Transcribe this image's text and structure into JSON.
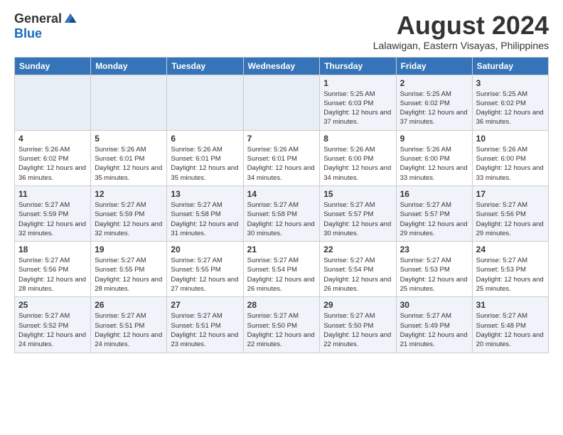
{
  "header": {
    "logo_general": "General",
    "logo_blue": "Blue",
    "month_year": "August 2024",
    "location": "Lalawigan, Eastern Visayas, Philippines"
  },
  "days_of_week": [
    "Sunday",
    "Monday",
    "Tuesday",
    "Wednesday",
    "Thursday",
    "Friday",
    "Saturday"
  ],
  "weeks": [
    [
      {
        "day": "",
        "info": ""
      },
      {
        "day": "",
        "info": ""
      },
      {
        "day": "",
        "info": ""
      },
      {
        "day": "",
        "info": ""
      },
      {
        "day": "1",
        "info": "Sunrise: 5:25 AM\nSunset: 6:03 PM\nDaylight: 12 hours and 37 minutes."
      },
      {
        "day": "2",
        "info": "Sunrise: 5:25 AM\nSunset: 6:02 PM\nDaylight: 12 hours and 37 minutes."
      },
      {
        "day": "3",
        "info": "Sunrise: 5:25 AM\nSunset: 6:02 PM\nDaylight: 12 hours and 36 minutes."
      }
    ],
    [
      {
        "day": "4",
        "info": "Sunrise: 5:26 AM\nSunset: 6:02 PM\nDaylight: 12 hours and 36 minutes."
      },
      {
        "day": "5",
        "info": "Sunrise: 5:26 AM\nSunset: 6:01 PM\nDaylight: 12 hours and 35 minutes."
      },
      {
        "day": "6",
        "info": "Sunrise: 5:26 AM\nSunset: 6:01 PM\nDaylight: 12 hours and 35 minutes."
      },
      {
        "day": "7",
        "info": "Sunrise: 5:26 AM\nSunset: 6:01 PM\nDaylight: 12 hours and 34 minutes."
      },
      {
        "day": "8",
        "info": "Sunrise: 5:26 AM\nSunset: 6:00 PM\nDaylight: 12 hours and 34 minutes."
      },
      {
        "day": "9",
        "info": "Sunrise: 5:26 AM\nSunset: 6:00 PM\nDaylight: 12 hours and 33 minutes."
      },
      {
        "day": "10",
        "info": "Sunrise: 5:26 AM\nSunset: 6:00 PM\nDaylight: 12 hours and 33 minutes."
      }
    ],
    [
      {
        "day": "11",
        "info": "Sunrise: 5:27 AM\nSunset: 5:59 PM\nDaylight: 12 hours and 32 minutes."
      },
      {
        "day": "12",
        "info": "Sunrise: 5:27 AM\nSunset: 5:59 PM\nDaylight: 12 hours and 32 minutes."
      },
      {
        "day": "13",
        "info": "Sunrise: 5:27 AM\nSunset: 5:58 PM\nDaylight: 12 hours and 31 minutes."
      },
      {
        "day": "14",
        "info": "Sunrise: 5:27 AM\nSunset: 5:58 PM\nDaylight: 12 hours and 30 minutes."
      },
      {
        "day": "15",
        "info": "Sunrise: 5:27 AM\nSunset: 5:57 PM\nDaylight: 12 hours and 30 minutes."
      },
      {
        "day": "16",
        "info": "Sunrise: 5:27 AM\nSunset: 5:57 PM\nDaylight: 12 hours and 29 minutes."
      },
      {
        "day": "17",
        "info": "Sunrise: 5:27 AM\nSunset: 5:56 PM\nDaylight: 12 hours and 29 minutes."
      }
    ],
    [
      {
        "day": "18",
        "info": "Sunrise: 5:27 AM\nSunset: 5:56 PM\nDaylight: 12 hours and 28 minutes."
      },
      {
        "day": "19",
        "info": "Sunrise: 5:27 AM\nSunset: 5:55 PM\nDaylight: 12 hours and 28 minutes."
      },
      {
        "day": "20",
        "info": "Sunrise: 5:27 AM\nSunset: 5:55 PM\nDaylight: 12 hours and 27 minutes."
      },
      {
        "day": "21",
        "info": "Sunrise: 5:27 AM\nSunset: 5:54 PM\nDaylight: 12 hours and 26 minutes."
      },
      {
        "day": "22",
        "info": "Sunrise: 5:27 AM\nSunset: 5:54 PM\nDaylight: 12 hours and 26 minutes."
      },
      {
        "day": "23",
        "info": "Sunrise: 5:27 AM\nSunset: 5:53 PM\nDaylight: 12 hours and 25 minutes."
      },
      {
        "day": "24",
        "info": "Sunrise: 5:27 AM\nSunset: 5:53 PM\nDaylight: 12 hours and 25 minutes."
      }
    ],
    [
      {
        "day": "25",
        "info": "Sunrise: 5:27 AM\nSunset: 5:52 PM\nDaylight: 12 hours and 24 minutes."
      },
      {
        "day": "26",
        "info": "Sunrise: 5:27 AM\nSunset: 5:51 PM\nDaylight: 12 hours and 24 minutes."
      },
      {
        "day": "27",
        "info": "Sunrise: 5:27 AM\nSunset: 5:51 PM\nDaylight: 12 hours and 23 minutes."
      },
      {
        "day": "28",
        "info": "Sunrise: 5:27 AM\nSunset: 5:50 PM\nDaylight: 12 hours and 22 minutes."
      },
      {
        "day": "29",
        "info": "Sunrise: 5:27 AM\nSunset: 5:50 PM\nDaylight: 12 hours and 22 minutes."
      },
      {
        "day": "30",
        "info": "Sunrise: 5:27 AM\nSunset: 5:49 PM\nDaylight: 12 hours and 21 minutes."
      },
      {
        "day": "31",
        "info": "Sunrise: 5:27 AM\nSunset: 5:48 PM\nDaylight: 12 hours and 20 minutes."
      }
    ]
  ]
}
